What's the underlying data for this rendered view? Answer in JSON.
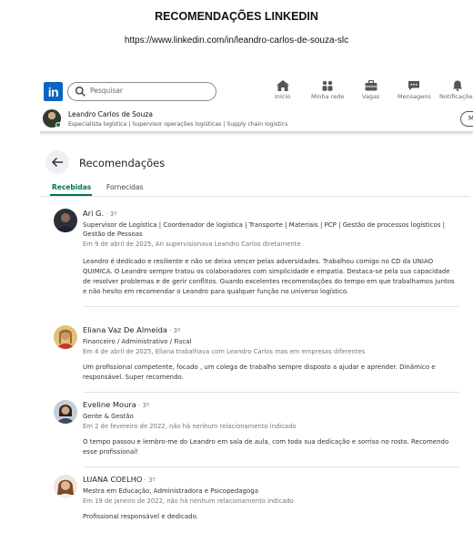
{
  "document": {
    "title": "RECOMENDAÇÕES LINKEDIN",
    "url": "https://www.linkedin.com/in/leandro-carlos-de-souza-slc"
  },
  "nav": {
    "logo_text": "in",
    "search_placeholder": "Pesquisar",
    "items": [
      {
        "label": "Início",
        "icon": "home-icon"
      },
      {
        "label": "Minha rede",
        "icon": "network-icon"
      },
      {
        "label": "Vagas",
        "icon": "briefcase-icon"
      },
      {
        "label": "Mensagens",
        "icon": "messaging-icon"
      },
      {
        "label": "Notificações",
        "icon": "bell-icon"
      }
    ]
  },
  "profile": {
    "name": "Leandro Carlos de Souza",
    "headline": "Especialista logística | Supervisor operações logísticas | Supply chain logistics",
    "more_button": "M"
  },
  "page": {
    "heading": "Recomendações",
    "tabs": [
      "Recebidas",
      "Fornecidas"
    ],
    "active_tab": "Recebidas"
  },
  "recommendations": [
    {
      "name": "Ari G.",
      "degree": " · 3º",
      "headline": "Supervisor de Logística | Coordenador de logística | Transporte | Materiais | PCP | Gestão de processos logísticos | Gestão de Pessoas",
      "date": "Em 9 de abril de 2025, Ari supervisionava Leandro Carlos diretamente",
      "text": "Leandro é dedicado e resiliente e não se deixa vencer pelas adversidades. Trabalhou comigo no CD da UNIAO QUIMICA. O Leandro sempre tratou os colaboradores com simplicidade e empatia. Destaca-se pela sua capacidade de resolver problemas e de gerir conflitos. Guardo excelentes recomendações do tempo em que trabalhamos juntos e não hesito em recomendar o Leandro para qualquer função no universo logístico."
    },
    {
      "name": "Eliana Vaz De Almeida",
      "degree": " · 3º",
      "headline": "Financeiro / Administrativo / Fiscal",
      "date": "Em 4 de abril de 2025, Eliana trabalhava com Leandro Carlos mas em empresas diferentes",
      "text": "Um profissional competente, focado , um colega de trabalho sempre disposto a ajudar e aprender. Dinâmico e responsável. Super recomendo."
    },
    {
      "name": "Eveline Moura",
      "degree": " · 3º",
      "headline": "Gente & Gestão",
      "date": "Em 2 de fevereiro de 2022, não há nenhum relacionamento indicado",
      "text": "O tempo passou e lembro-me do Leandro em sala de aula, com toda sua dedicação e sorriso no rosto. Recomendo esse profissional!"
    },
    {
      "name": "LUANA COELHO",
      "degree": " · 3º",
      "headline": "Mestra em Educação, Administradora e Psicopedagoga",
      "date": "Em 19 de janeiro de 2022, não há nenhum relacionamento indicado",
      "text": "Profissional responsável e dedicado."
    }
  ],
  "colors": {
    "linkedin_blue": "#0a66c2",
    "active_tab_green": "#01754f",
    "online_dot": "#057642"
  }
}
